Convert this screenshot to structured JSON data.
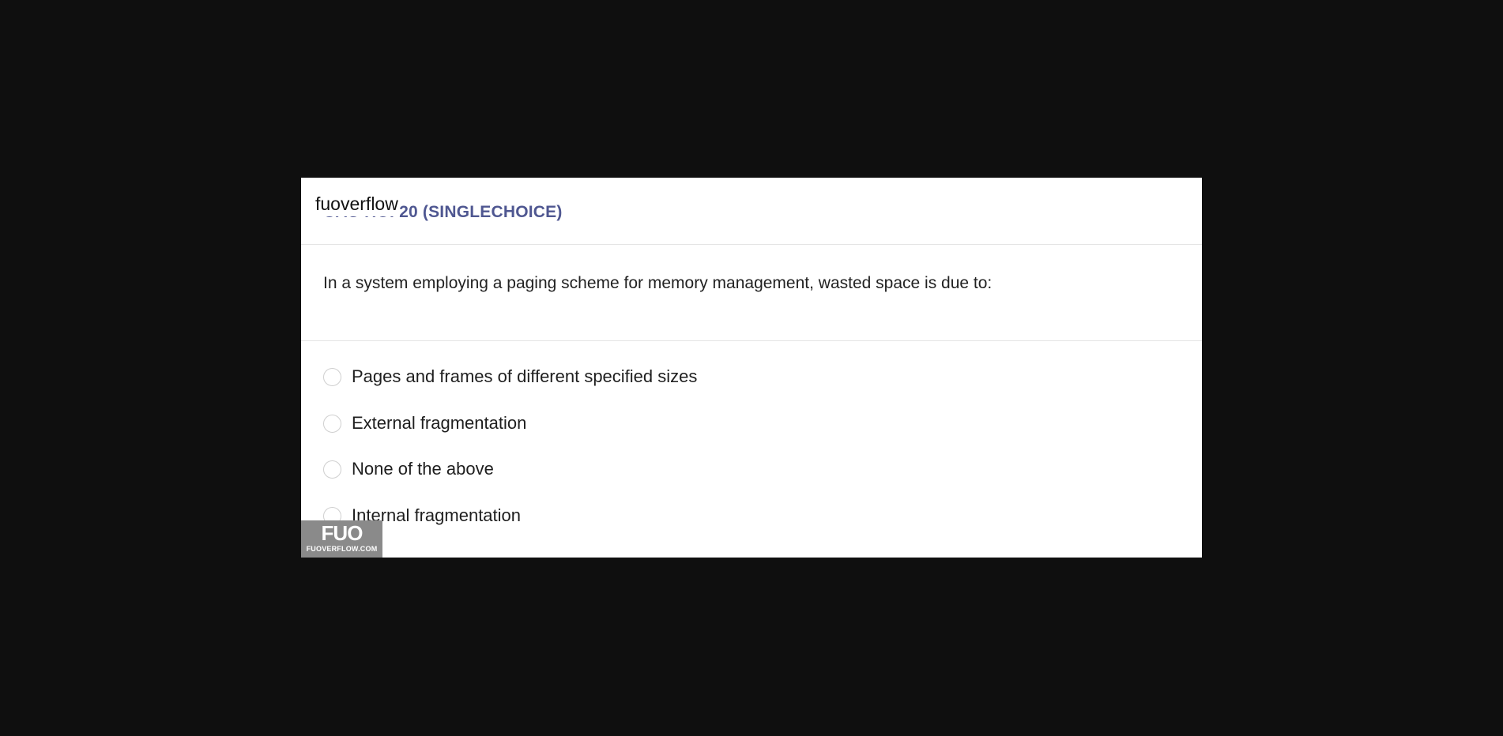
{
  "overlay": {
    "source_tag": "fuoverflow"
  },
  "question": {
    "label": "CÂU HỎI 20 (SINGLECHOICE)",
    "text": "In a system employing a paging scheme for memory management, wasted space is due to:",
    "options": [
      {
        "label": "Pages and frames of different specified sizes",
        "selected": false
      },
      {
        "label": "External fragmentation",
        "selected": false
      },
      {
        "label": "None of the above",
        "selected": false
      },
      {
        "label": "Internal fragmentation",
        "selected": false
      }
    ]
  },
  "watermark": {
    "logo": "FUO",
    "url": "FUOVERFLOW.COM"
  },
  "colors": {
    "background": "#0f0f0f",
    "panel": "#ffffff",
    "question_label": "#4f5791",
    "watermark_bg": "#8a8a8a"
  }
}
